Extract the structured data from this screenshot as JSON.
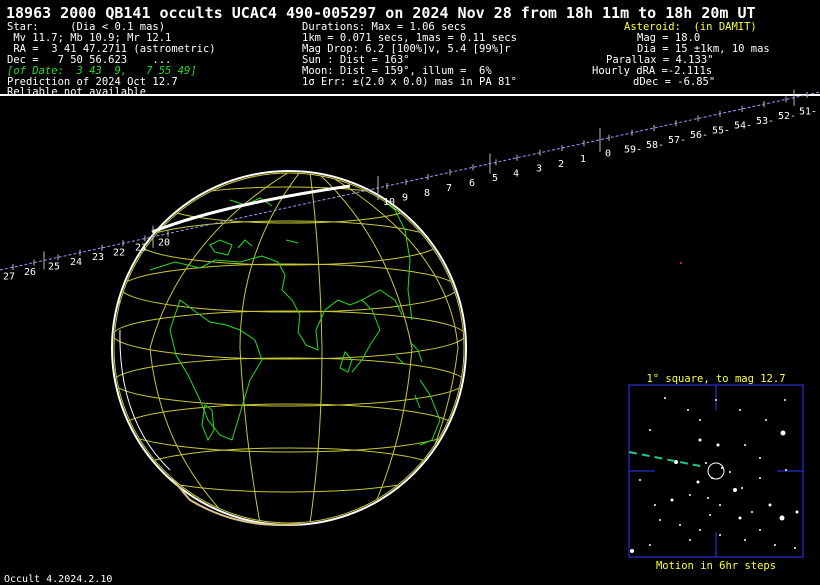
{
  "header": {
    "title": "18963 2000 QB141 occults UCAC4 490-005297 on 2024 Nov 28 from 18h 11m to 18h 20m UT",
    "star_col": [
      "Star:     (Dia < 0.1 mas)",
      " Mv 11.7; Mb 10.9; Mr 12.1",
      " RA =  3 41 47.2711 (astrometric)",
      "Dec =   7 50 56.623    ...",
      "[of Date:  3 43  9,   7 55 49]",
      "Prediction of 2024 Oct 12.7",
      "Reliable not available"
    ],
    "mid_col": [
      "Durations: Max = 1.06 secs",
      "1km = 0.071 secs, 1mas = 0.11 secs",
      "Mag Drop: 6.2 [100%]v, 5.4 [99%]r",
      "Sun : Dist = 163°",
      "Moon: Dist = 159°, illum =  6%",
      "1σ Err: ±(2.0 x 0.0) mas in PA 81°"
    ],
    "right_col": [
      "Asteroid:  (in DAMIT)",
      "Mag = 18.0",
      "Dia = 15 ±1km, 10 mas",
      "Parallax = 4.133\"",
      "Hourly dRA =-2.111s",
      "dDec = -6.85\""
    ]
  },
  "track": {
    "left_ticks": [
      "27",
      "26",
      "25",
      "24",
      "23",
      "22",
      "21",
      "20"
    ],
    "mid_ticks": [
      "10",
      "9",
      "8",
      "7",
      "6",
      "5",
      "4",
      "3",
      "2",
      "1",
      "0"
    ],
    "right_ticks": [
      "59-",
      "58-",
      "57-",
      "56-",
      "55-",
      "54-",
      "53-",
      "52-",
      "51-"
    ]
  },
  "starchart": {
    "title": "1° square, to mag 12.7",
    "footer": "Motion in 6hr steps"
  },
  "footer": {
    "version": "Occult 4.2024.2.10"
  },
  "colors": {
    "accent": "#ffff33",
    "land": "#22dd22",
    "grid": "#c8c832",
    "track": "#9999ff"
  }
}
